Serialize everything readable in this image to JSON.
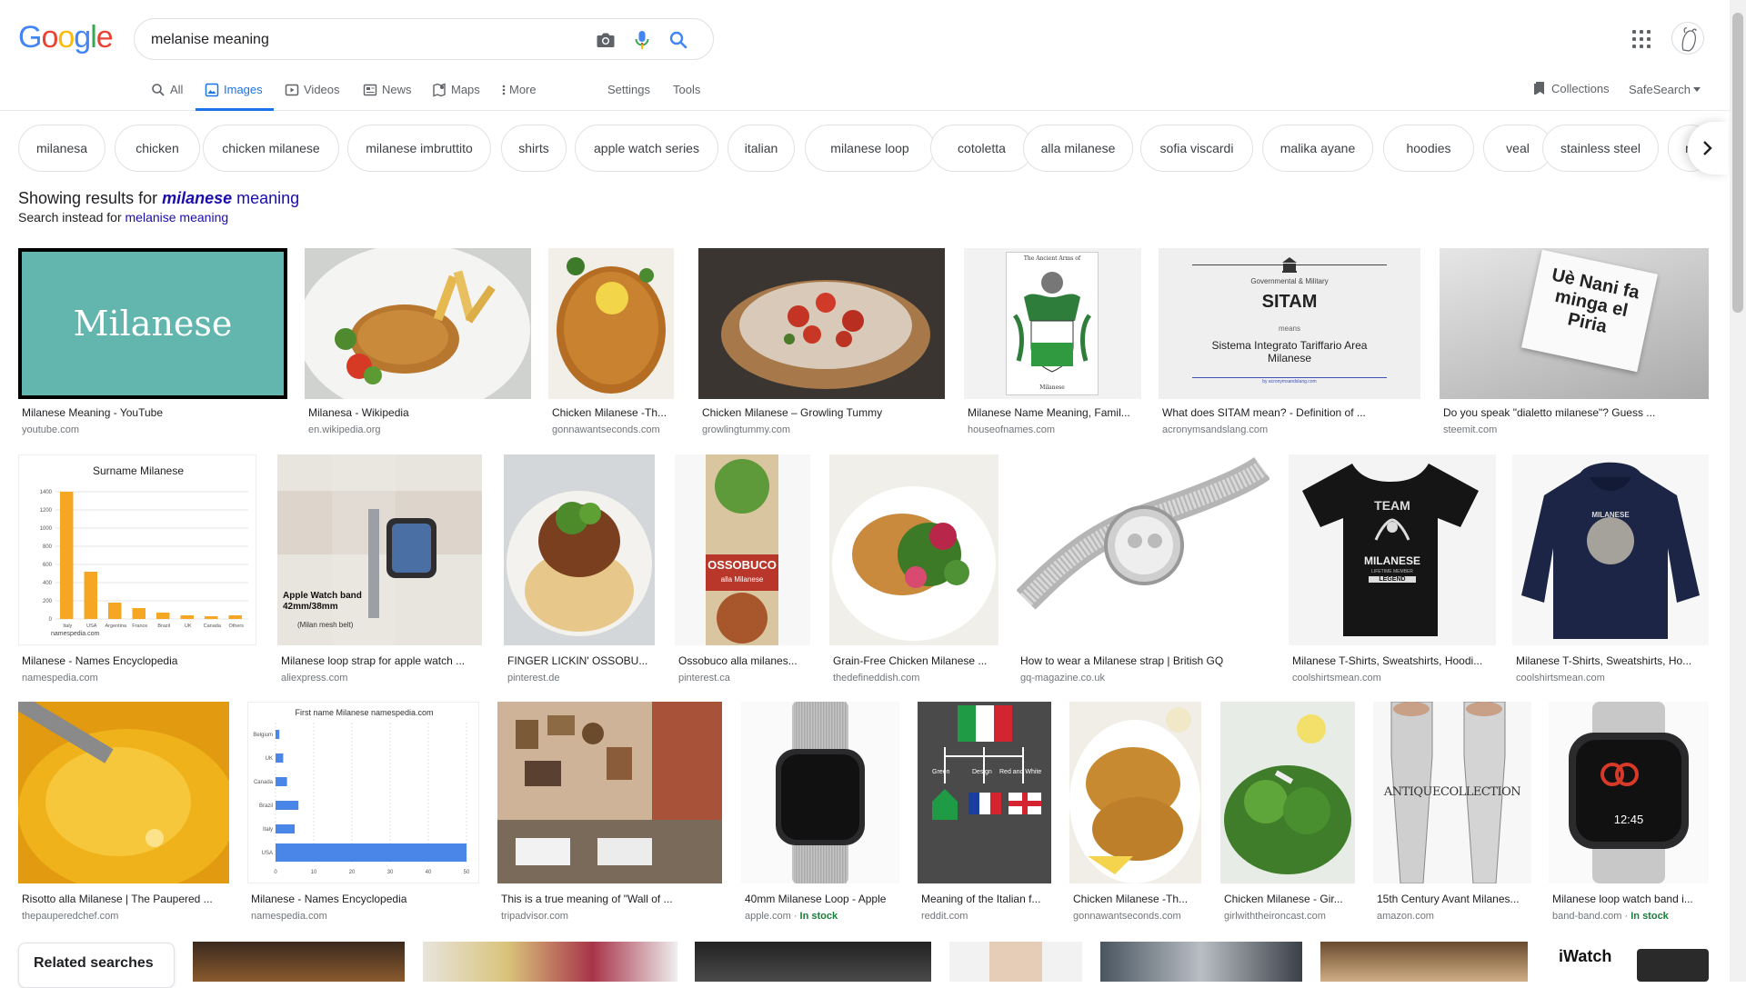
{
  "search": {
    "query": "melanise meaning"
  },
  "logo": {
    "letters": [
      "G",
      "o",
      "o",
      "g",
      "l",
      "e"
    ],
    "colors": [
      "#4285f4",
      "#ea4335",
      "#fbbc05",
      "#4285f4",
      "#34a853",
      "#ea4335"
    ]
  },
  "tabs": [
    {
      "label": "All",
      "icon": "search-icon"
    },
    {
      "label": "Images",
      "icon": "image-icon",
      "active": true
    },
    {
      "label": "Videos",
      "icon": "video-icon"
    },
    {
      "label": "News",
      "icon": "news-icon"
    },
    {
      "label": "Maps",
      "icon": "map-icon"
    },
    {
      "label": "More",
      "icon": "more-vert-icon"
    }
  ],
  "tools": {
    "settings": "Settings",
    "tools": "Tools",
    "collections": "Collections",
    "safesearch": "SafeSearch"
  },
  "chips": [
    "milanesa",
    "chicken",
    "chicken milanese",
    "milanese imbruttito",
    "shirts",
    "apple watch series",
    "italian",
    "milanese loop",
    "cotoletta",
    "alla milanese",
    "sofia viscardi",
    "malika ayane",
    "hoodies",
    "veal",
    "stainless steel",
    "m"
  ],
  "correction": {
    "prefix": "Showing results for ",
    "corrected_bold": "milanese",
    "corrected_rest": " meaning",
    "instead_prefix": "Search instead for ",
    "instead_link": "melanise meaning"
  },
  "thumb_text": {
    "milanese_word": "Milanese",
    "arms_title": "The Ancient Arms of",
    "arms_name": "Milanese",
    "sitam_sub": "Governmental & Military",
    "sitam_title": "SITAM",
    "sitam_means": "means",
    "sitam_full": "Sistema Integrato Tariffario Area Milanese",
    "sitam_by": "by acronymsandslang.com",
    "piria": "Uè Nani fa minga el Piria",
    "surname_title": "Surname Milanese",
    "surname_ticks": [
      "1400",
      "1200",
      "1000",
      "800",
      "600",
      "400",
      "200",
      "0"
    ],
    "surname_cats": [
      "Italy",
      "USA",
      "Argentina",
      "France",
      "Brazil",
      "UK",
      "Canada",
      "Others"
    ],
    "surname_values": [
      1400,
      520,
      180,
      120,
      70,
      40,
      30,
      40
    ],
    "surname_src": "namespedia.com",
    "watch_band": "Apple Watch band 42mm/38mm",
    "watch_band_sub": "(Milan mesh belt)",
    "ossobuco": "OSSOBUCO",
    "ossobuco_sub": "alla Milanese",
    "tshirt_team": "TEAM",
    "tshirt_name": "MILANESE",
    "tshirt_sub": "LIFETIME MEMBER",
    "tshirt_legend": "LEGEND",
    "hoodie_name": "MILANESE",
    "firstname_title": "First name Milanese namespedia.com",
    "firstname_cats": [
      "Belgium",
      "UK",
      "Canada",
      "Brazil",
      "Italy",
      "USA"
    ],
    "firstname_values": [
      1,
      2,
      3,
      6,
      5,
      50
    ],
    "firstname_ticks": [
      "0",
      "10",
      "20",
      "30",
      "40",
      "50"
    ],
    "flag_labels": [
      "Green",
      "Design",
      "Red and White"
    ],
    "antique": "ANTIQUECOLLECTION",
    "iwatch_time": "12:45",
    "iwatch_bottom": "iWatch"
  },
  "rows": [
    [
      {
        "caption": "Milanese Meaning - YouTube",
        "source": "youtube.com"
      },
      {
        "caption": "Milanesa - Wikipedia",
        "source": "en.wikipedia.org"
      },
      {
        "caption": "Chicken Milanese -Th...",
        "source": "gonnawantseconds.com"
      },
      {
        "caption": "Chicken Milanese – Growling Tummy",
        "source": "growlingtummy.com"
      },
      {
        "caption": "Milanese Name Meaning, Famil...",
        "source": "houseofnames.com"
      },
      {
        "caption": "What does SITAM mean? - Definition of ...",
        "source": "acronymsandslang.com"
      },
      {
        "caption": "Do you speak \"dialetto milanese\"? Guess ...",
        "source": "steemit.com"
      }
    ],
    [
      {
        "caption": "Milanese - Names Encyclopedia",
        "source": "namespedia.com"
      },
      {
        "caption": "Milanese loop strap for apple watch ...",
        "source": "aliexpress.com"
      },
      {
        "caption": "FINGER LICKIN' OSSOBU...",
        "source": "pinterest.de"
      },
      {
        "caption": "Ossobuco alla milanes...",
        "source": "pinterest.ca"
      },
      {
        "caption": "Grain-Free Chicken Milanese ...",
        "source": "thedefineddish.com"
      },
      {
        "caption": "How to wear a Milanese strap | British GQ",
        "source": "gq-magazine.co.uk"
      },
      {
        "caption": "Milanese T-Shirts, Sweatshirts, Hoodi...",
        "source": "coolshirtsmean.com"
      },
      {
        "caption": "Milanese T-Shirts, Sweatshirts, Ho...",
        "source": "coolshirtsmean.com"
      }
    ],
    [
      {
        "caption": "Risotto alla Milanese | The Paupered ...",
        "source": "thepauperedchef.com"
      },
      {
        "caption": "Milanese - Names Encyclopedia",
        "source": "namespedia.com"
      },
      {
        "caption": "This is a true meaning of \"Wall of ...",
        "source": "tripadvisor.com"
      },
      {
        "caption": "40mm Milanese Loop - Apple",
        "source": "apple.com",
        "stock": "In stock"
      },
      {
        "caption": "Meaning of the Italian f...",
        "source": "reddit.com"
      },
      {
        "caption": "Chicken Milanese -Th...",
        "source": "gonnawantseconds.com"
      },
      {
        "caption": "Chicken Milanese - Gir...",
        "source": "girlwiththeironcast.com"
      },
      {
        "caption": "15th Century Avant Milanes...",
        "source": "amazon.com"
      },
      {
        "caption": "Milanese loop watch band i...",
        "source": "band-band.com",
        "stock": "In stock"
      }
    ]
  ],
  "related": {
    "label": "Related searches"
  },
  "colors": {
    "accent": "#1a73e8",
    "link": "#1a0dab",
    "stock": "#188038"
  }
}
